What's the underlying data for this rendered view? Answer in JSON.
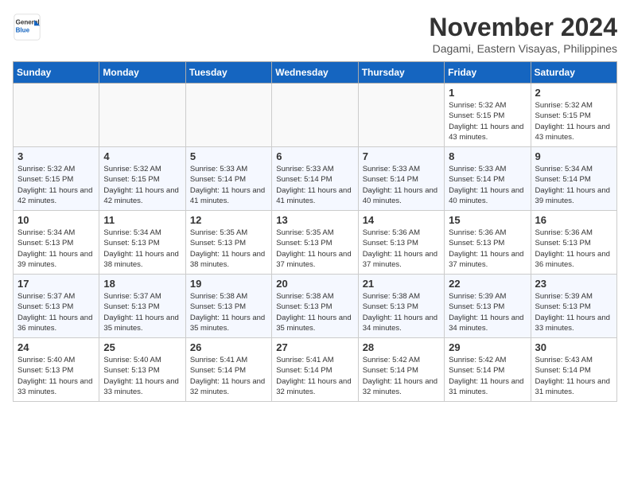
{
  "header": {
    "logo_line1": "General",
    "logo_line2": "Blue",
    "month": "November 2024",
    "location": "Dagami, Eastern Visayas, Philippines"
  },
  "weekdays": [
    "Sunday",
    "Monday",
    "Tuesday",
    "Wednesday",
    "Thursday",
    "Friday",
    "Saturday"
  ],
  "weeks": [
    [
      {
        "day": "",
        "info": ""
      },
      {
        "day": "",
        "info": ""
      },
      {
        "day": "",
        "info": ""
      },
      {
        "day": "",
        "info": ""
      },
      {
        "day": "",
        "info": ""
      },
      {
        "day": "1",
        "info": "Sunrise: 5:32 AM\nSunset: 5:15 PM\nDaylight: 11 hours and 43 minutes."
      },
      {
        "day": "2",
        "info": "Sunrise: 5:32 AM\nSunset: 5:15 PM\nDaylight: 11 hours and 43 minutes."
      }
    ],
    [
      {
        "day": "3",
        "info": "Sunrise: 5:32 AM\nSunset: 5:15 PM\nDaylight: 11 hours and 42 minutes."
      },
      {
        "day": "4",
        "info": "Sunrise: 5:32 AM\nSunset: 5:15 PM\nDaylight: 11 hours and 42 minutes."
      },
      {
        "day": "5",
        "info": "Sunrise: 5:33 AM\nSunset: 5:14 PM\nDaylight: 11 hours and 41 minutes."
      },
      {
        "day": "6",
        "info": "Sunrise: 5:33 AM\nSunset: 5:14 PM\nDaylight: 11 hours and 41 minutes."
      },
      {
        "day": "7",
        "info": "Sunrise: 5:33 AM\nSunset: 5:14 PM\nDaylight: 11 hours and 40 minutes."
      },
      {
        "day": "8",
        "info": "Sunrise: 5:33 AM\nSunset: 5:14 PM\nDaylight: 11 hours and 40 minutes."
      },
      {
        "day": "9",
        "info": "Sunrise: 5:34 AM\nSunset: 5:14 PM\nDaylight: 11 hours and 39 minutes."
      }
    ],
    [
      {
        "day": "10",
        "info": "Sunrise: 5:34 AM\nSunset: 5:13 PM\nDaylight: 11 hours and 39 minutes."
      },
      {
        "day": "11",
        "info": "Sunrise: 5:34 AM\nSunset: 5:13 PM\nDaylight: 11 hours and 38 minutes."
      },
      {
        "day": "12",
        "info": "Sunrise: 5:35 AM\nSunset: 5:13 PM\nDaylight: 11 hours and 38 minutes."
      },
      {
        "day": "13",
        "info": "Sunrise: 5:35 AM\nSunset: 5:13 PM\nDaylight: 11 hours and 37 minutes."
      },
      {
        "day": "14",
        "info": "Sunrise: 5:36 AM\nSunset: 5:13 PM\nDaylight: 11 hours and 37 minutes."
      },
      {
        "day": "15",
        "info": "Sunrise: 5:36 AM\nSunset: 5:13 PM\nDaylight: 11 hours and 37 minutes."
      },
      {
        "day": "16",
        "info": "Sunrise: 5:36 AM\nSunset: 5:13 PM\nDaylight: 11 hours and 36 minutes."
      }
    ],
    [
      {
        "day": "17",
        "info": "Sunrise: 5:37 AM\nSunset: 5:13 PM\nDaylight: 11 hours and 36 minutes."
      },
      {
        "day": "18",
        "info": "Sunrise: 5:37 AM\nSunset: 5:13 PM\nDaylight: 11 hours and 35 minutes."
      },
      {
        "day": "19",
        "info": "Sunrise: 5:38 AM\nSunset: 5:13 PM\nDaylight: 11 hours and 35 minutes."
      },
      {
        "day": "20",
        "info": "Sunrise: 5:38 AM\nSunset: 5:13 PM\nDaylight: 11 hours and 35 minutes."
      },
      {
        "day": "21",
        "info": "Sunrise: 5:38 AM\nSunset: 5:13 PM\nDaylight: 11 hours and 34 minutes."
      },
      {
        "day": "22",
        "info": "Sunrise: 5:39 AM\nSunset: 5:13 PM\nDaylight: 11 hours and 34 minutes."
      },
      {
        "day": "23",
        "info": "Sunrise: 5:39 AM\nSunset: 5:13 PM\nDaylight: 11 hours and 33 minutes."
      }
    ],
    [
      {
        "day": "24",
        "info": "Sunrise: 5:40 AM\nSunset: 5:13 PM\nDaylight: 11 hours and 33 minutes."
      },
      {
        "day": "25",
        "info": "Sunrise: 5:40 AM\nSunset: 5:13 PM\nDaylight: 11 hours and 33 minutes."
      },
      {
        "day": "26",
        "info": "Sunrise: 5:41 AM\nSunset: 5:14 PM\nDaylight: 11 hours and 32 minutes."
      },
      {
        "day": "27",
        "info": "Sunrise: 5:41 AM\nSunset: 5:14 PM\nDaylight: 11 hours and 32 minutes."
      },
      {
        "day": "28",
        "info": "Sunrise: 5:42 AM\nSunset: 5:14 PM\nDaylight: 11 hours and 32 minutes."
      },
      {
        "day": "29",
        "info": "Sunrise: 5:42 AM\nSunset: 5:14 PM\nDaylight: 11 hours and 31 minutes."
      },
      {
        "day": "30",
        "info": "Sunrise: 5:43 AM\nSunset: 5:14 PM\nDaylight: 11 hours and 31 minutes."
      }
    ]
  ]
}
